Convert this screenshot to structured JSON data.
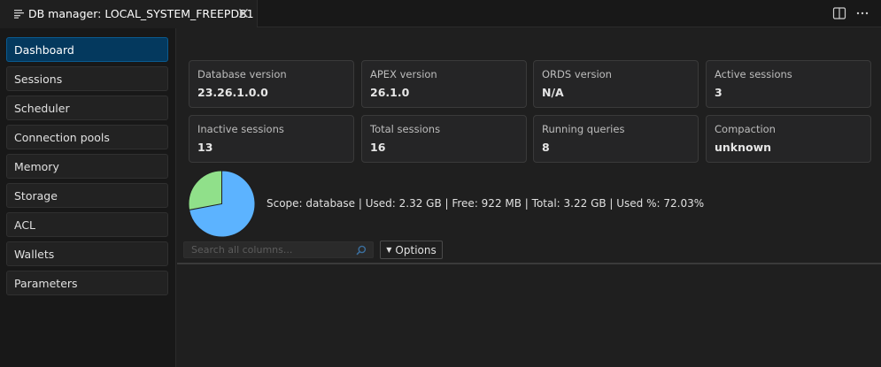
{
  "tab": {
    "title": "DB manager: LOCAL_SYSTEM_FREEPDB1"
  },
  "sidebar": {
    "items": [
      {
        "label": "Dashboard"
      },
      {
        "label": "Sessions"
      },
      {
        "label": "Scheduler"
      },
      {
        "label": "Connection pools"
      },
      {
        "label": "Memory"
      },
      {
        "label": "Storage"
      },
      {
        "label": "ACL"
      },
      {
        "label": "Wallets"
      },
      {
        "label": "Parameters"
      }
    ],
    "active": "Dashboard"
  },
  "cards": [
    {
      "label": "Database version",
      "value": "23.26.1.0.0"
    },
    {
      "label": "APEX version",
      "value": "26.1.0"
    },
    {
      "label": "ORDS version",
      "value": "N/A"
    },
    {
      "label": "Active sessions",
      "value": "3"
    },
    {
      "label": "Inactive sessions",
      "value": "13"
    },
    {
      "label": "Total sessions",
      "value": "16"
    },
    {
      "label": "Running queries",
      "value": "8"
    },
    {
      "label": "Compaction",
      "value": "unknown"
    }
  ],
  "storage": {
    "summary": "Scope: database | Used: 2.32 GB | Free: 922 MB | Total: 3.22 GB | Used %: 72.03%",
    "used_percent": 72.03,
    "used_color": "#5cb3ff",
    "free_color": "#90e08a"
  },
  "search": {
    "placeholder": "Search all columns..."
  },
  "options": {
    "label": "Options"
  },
  "icons": {
    "tab": "list-icon",
    "close": "close-icon",
    "split": "split-editor-icon",
    "more": "more-actions-icon",
    "search": "search-icon",
    "caret": "caret-down-icon"
  }
}
